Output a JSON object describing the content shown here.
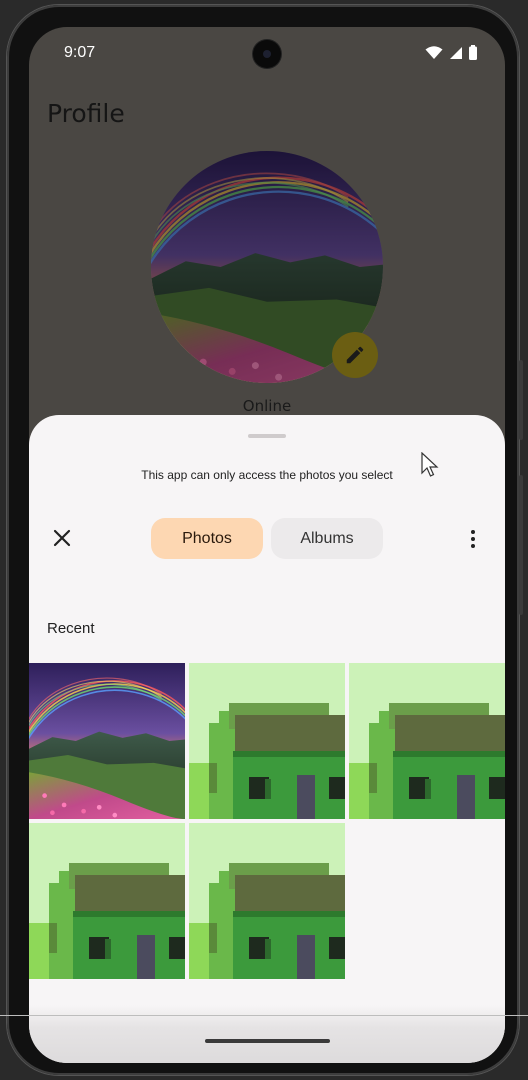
{
  "status_bar": {
    "time": "9:07",
    "icons": [
      "wifi-icon",
      "signal-icon",
      "battery-icon"
    ]
  },
  "app": {
    "title": "Profile",
    "status_label": "Online",
    "edit_icon": "pencil-icon"
  },
  "photo_picker": {
    "notice": "This app can only access the photos you select",
    "close_icon": "close-icon",
    "tabs": [
      {
        "label": "Photos",
        "selected": true
      },
      {
        "label": "Albums",
        "selected": false
      }
    ],
    "more_icon": "more-vert-icon",
    "section_label": "Recent",
    "items": [
      {
        "type": "landscape-photo"
      },
      {
        "type": "pixel-house-image"
      },
      {
        "type": "pixel-house-image"
      },
      {
        "type": "pixel-house-image"
      },
      {
        "type": "pixel-house-image"
      }
    ]
  },
  "colors": {
    "selected_tab": "#fdd7b2",
    "unselected_tab": "#eceaeb",
    "sheet_background": "#f7f5f6",
    "scrim_background": "#4a4743",
    "edit_fab": "#6b5e12"
  }
}
